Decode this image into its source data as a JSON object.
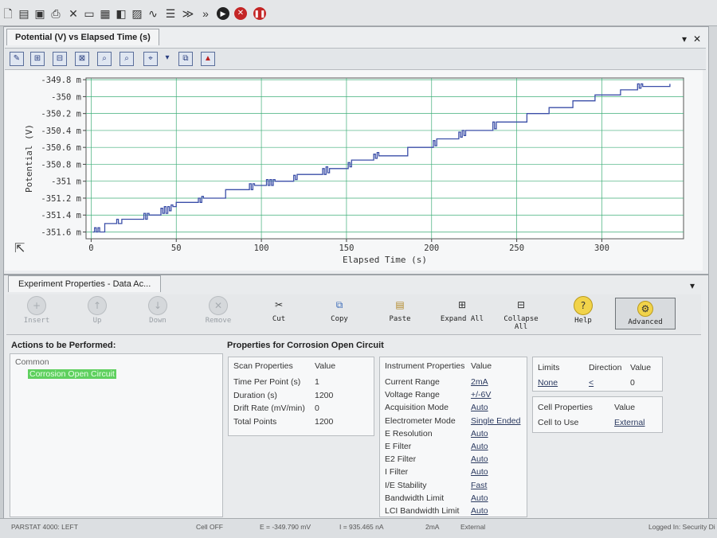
{
  "chart_window": {
    "tab_title": "Potential (V) vs Elapsed Time (s)",
    "controls": {
      "dropdown": "▾",
      "close": "✕"
    }
  },
  "chart_data": {
    "type": "line",
    "xlabel": "Elapsed Time (s)",
    "ylabel": "Potential (V)",
    "xlim": [
      -3,
      348
    ],
    "ylim": [
      -351.68,
      -349.78
    ],
    "x_ticks": [
      0,
      50,
      100,
      150,
      200,
      250,
      300
    ],
    "x_tick_labels": [
      "0",
      "50",
      "100",
      "150",
      "200",
      "250",
      "300"
    ],
    "y_ticks": [
      -349.8,
      -350,
      -350.2,
      -350.4,
      -350.6,
      -350.8,
      -351,
      -351.2,
      -351.4,
      -351.6
    ],
    "y_tick_labels": [
      "-349.8 m",
      "-350 m",
      "-350.2 m",
      "-350.4 m",
      "-350.6 m",
      "-350.8 m",
      "-351 m",
      "-351.2 m",
      "-351.4 m",
      "-351.6 m"
    ],
    "grid": true,
    "series": [
      {
        "color": "#3b4fa8",
        "x": [
          1,
          2,
          3,
          4,
          5,
          8,
          14,
          15,
          16,
          18,
          30,
          31,
          32,
          33,
          34,
          40,
          41,
          42,
          43,
          44,
          45,
          46,
          47,
          48,
          49,
          50,
          62,
          63,
          64,
          65,
          66,
          78,
          79,
          92,
          93,
          94,
          95,
          96,
          102,
          103,
          104,
          105,
          106,
          107,
          108,
          118,
          119,
          120,
          121,
          135,
          136,
          137,
          138,
          139,
          140,
          150,
          151,
          152,
          153,
          165,
          166,
          167,
          168,
          169,
          185,
          186,
          187,
          200,
          201,
          202,
          203,
          215,
          216,
          217,
          218,
          219,
          220,
          235,
          236,
          237,
          238,
          255,
          256,
          257,
          268,
          269,
          270,
          282,
          283,
          284,
          295,
          296,
          310,
          311,
          320,
          321,
          322,
          323,
          324,
          340
        ],
        "y": [
          -351.6,
          -351.55,
          -351.6,
          -351.55,
          -351.6,
          -351.5,
          -351.5,
          -351.45,
          -351.5,
          -351.45,
          -351.45,
          -351.38,
          -351.45,
          -351.38,
          -351.4,
          -351.4,
          -351.32,
          -351.38,
          -351.3,
          -351.38,
          -351.3,
          -351.35,
          -351.28,
          -351.3,
          -351.3,
          -351.25,
          -351.25,
          -351.2,
          -351.25,
          -351.18,
          -351.2,
          -351.2,
          -351.1,
          -351.1,
          -351.03,
          -351.1,
          -351.03,
          -351.05,
          -351.05,
          -350.98,
          -351.05,
          -350.98,
          -351.05,
          -350.98,
          -351.0,
          -351.0,
          -350.93,
          -350.98,
          -350.92,
          -350.92,
          -350.85,
          -350.92,
          -350.83,
          -350.9,
          -350.85,
          -350.85,
          -350.78,
          -350.83,
          -350.75,
          -350.75,
          -350.68,
          -350.73,
          -350.66,
          -350.7,
          -350.7,
          -350.6,
          -350.6,
          -350.6,
          -350.52,
          -350.58,
          -350.5,
          -350.5,
          -350.42,
          -350.48,
          -350.4,
          -350.46,
          -350.4,
          -350.4,
          -350.3,
          -350.38,
          -350.3,
          -350.3,
          -350.2,
          -350.2,
          -350.2,
          -350.13,
          -350.13,
          -350.13,
          -350.05,
          -350.05,
          -350.05,
          -349.98,
          -349.98,
          -349.92,
          -349.92,
          -349.85,
          -349.9,
          -349.85,
          -349.88,
          -349.85
        ]
      }
    ]
  },
  "properties_window": {
    "tab_title": "Experiment Properties - Data Ac...",
    "collapse": "▾",
    "commands": [
      {
        "label": "Insert",
        "icon": "plus-icon",
        "enabled": false
      },
      {
        "label": "Up",
        "icon": "up-arrow-icon",
        "enabled": false
      },
      {
        "label": "Down",
        "icon": "down-arrow-icon",
        "enabled": false
      },
      {
        "label": "Remove",
        "icon": "remove-icon",
        "enabled": false
      },
      {
        "label": "Cut",
        "icon": "scissors-icon",
        "enabled": true
      },
      {
        "label": "Copy",
        "icon": "copy-icon",
        "enabled": true
      },
      {
        "label": "Paste",
        "icon": "paste-icon",
        "enabled": true
      },
      {
        "label": "Expand All",
        "icon": "expand-icon",
        "enabled": true
      },
      {
        "label": "Collapse All",
        "icon": "collapse-icon",
        "enabled": true
      },
      {
        "label": "Help",
        "icon": "help-icon",
        "enabled": true
      },
      {
        "label": "Advanced",
        "icon": "advanced-icon",
        "enabled": true
      }
    ],
    "actions_title": "Actions to be Performed:",
    "tree_root": "Common",
    "tree_selected": "Corrosion Open Circuit",
    "properties_title": "Properties for Corrosion Open Circuit",
    "scan": {
      "header_name": "Scan Properties",
      "header_value": "Value",
      "rows": [
        {
          "name": "Time Per Point (s)",
          "value": "1"
        },
        {
          "name": "Duration (s)",
          "value": "1200"
        },
        {
          "name": "Drift Rate (mV/min)",
          "value": "0"
        },
        {
          "name": "Total Points",
          "value": "1200"
        }
      ]
    },
    "instrument": {
      "header_name": "Instrument Properties",
      "header_value": "Value",
      "rows": [
        {
          "name": "Current Range",
          "value": "2mA"
        },
        {
          "name": "Voltage Range",
          "value": "+/-6V"
        },
        {
          "name": "Acquisition Mode",
          "value": "Auto"
        },
        {
          "name": "Electrometer Mode",
          "value": "Single Ended"
        },
        {
          "name": "E Resolution",
          "value": "Auto"
        },
        {
          "name": "E Filter",
          "value": "Auto"
        },
        {
          "name": "E2 Filter",
          "value": "Auto"
        },
        {
          "name": "I Filter",
          "value": "Auto"
        },
        {
          "name": "I/E Stability",
          "value": "Fast"
        },
        {
          "name": "Bandwidth Limit",
          "value": "Auto"
        },
        {
          "name": "LCI Bandwidth Limit",
          "value": "Auto"
        }
      ]
    },
    "limits": {
      "h1": "Limits",
      "h2": "Direction",
      "h3": "Value",
      "v1": "None",
      "v2": "<",
      "v3": "0"
    },
    "cell": {
      "h1": "Cell Properties",
      "h2": "Value",
      "name": "Cell to Use",
      "value": "External"
    }
  },
  "status_bar": {
    "instrument": "PARSTAT 4000: LEFT",
    "cell": "Cell OFF",
    "potential": "E = -349.790 mV",
    "current": "I = 935.465 nA",
    "range": "2mA",
    "mode": "External",
    "login": "Logged In: Security Di"
  }
}
